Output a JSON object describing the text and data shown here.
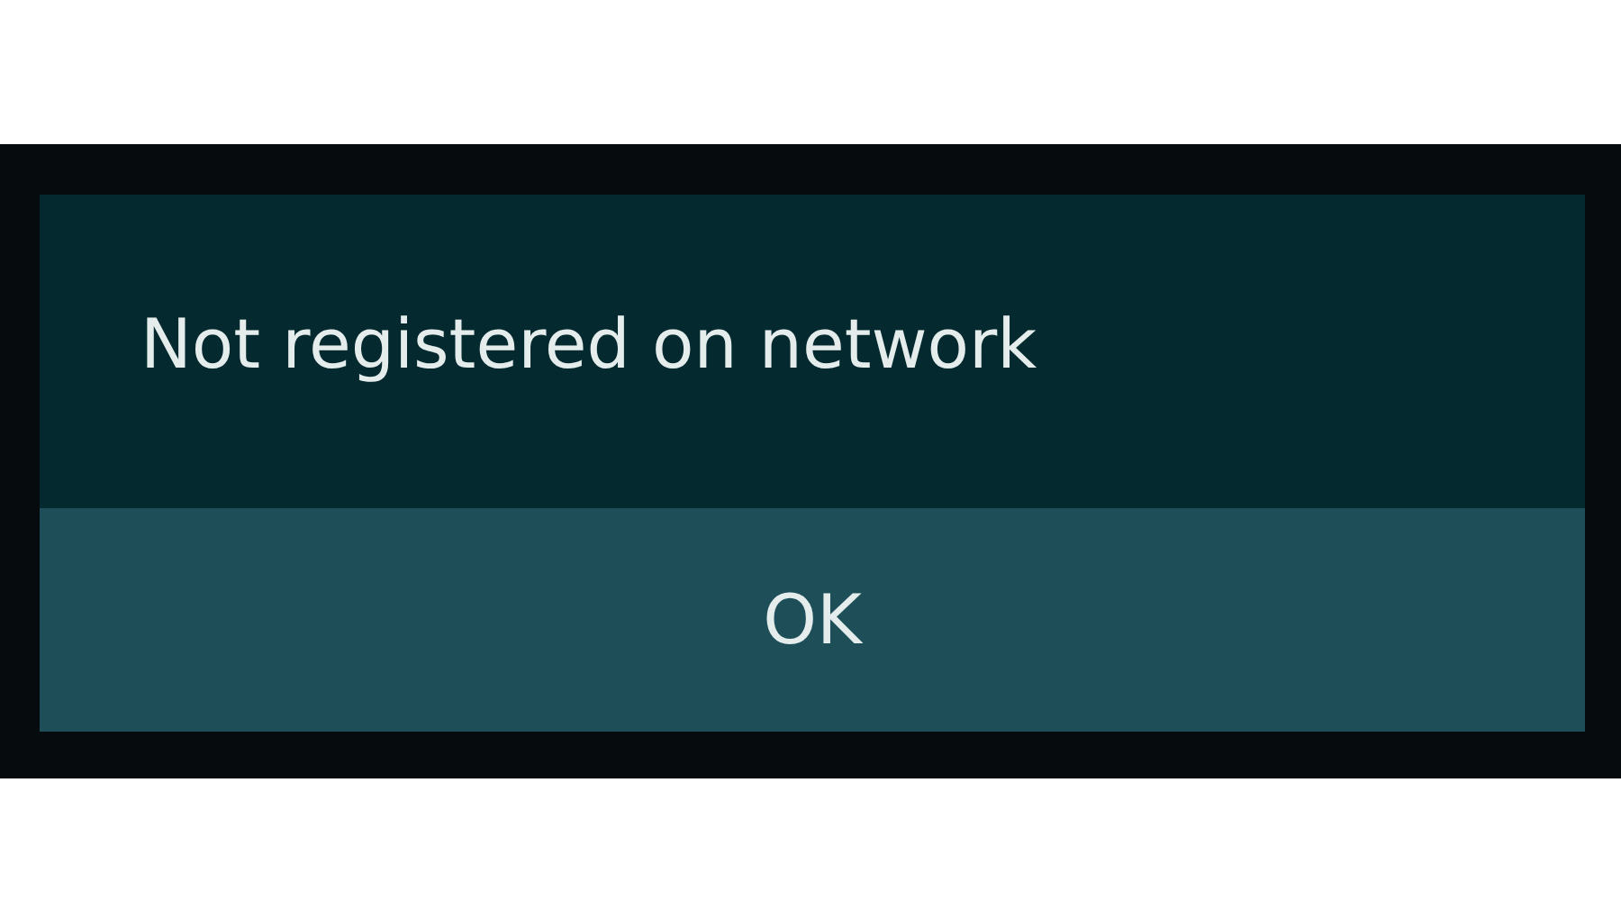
{
  "dialog": {
    "message": "Not registered on network",
    "buttons": [
      "OK"
    ]
  }
}
